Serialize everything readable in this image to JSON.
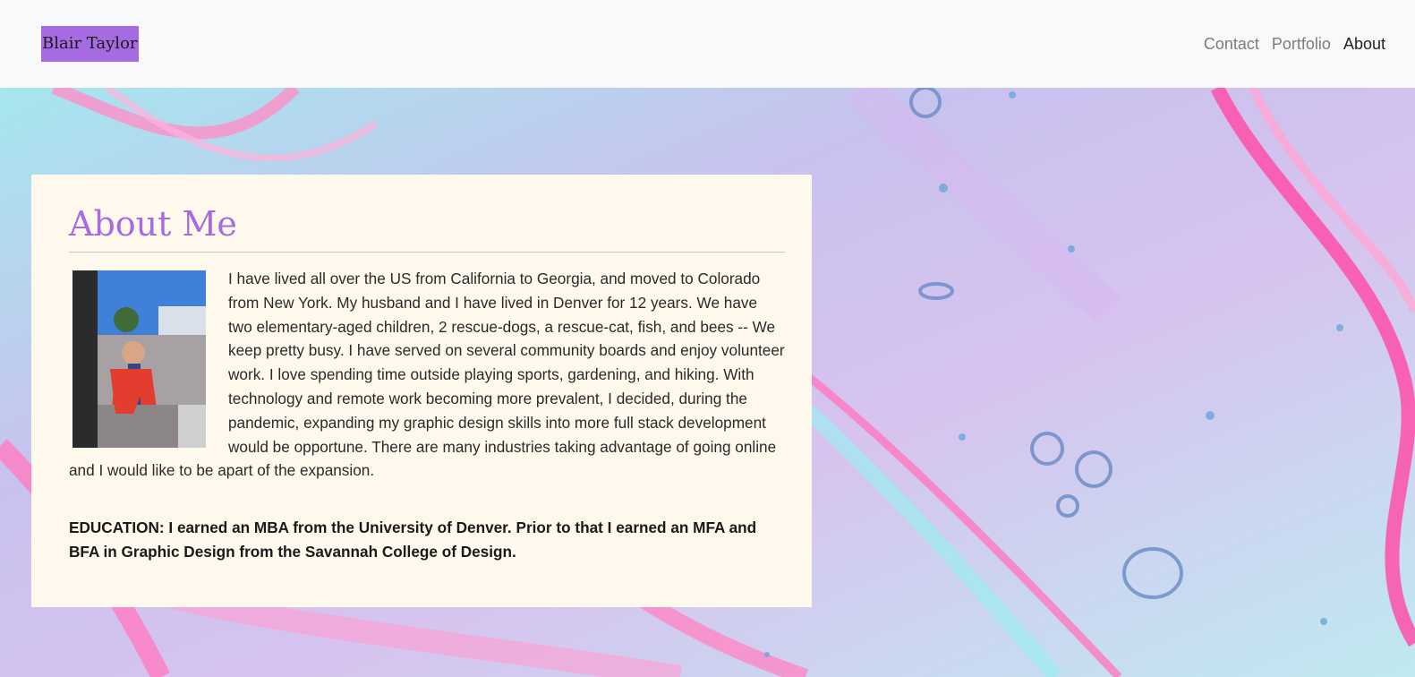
{
  "nav": {
    "brand": "Blair Taylor",
    "links": [
      "Contact",
      "Portfolio",
      "About"
    ],
    "active": "About"
  },
  "about": {
    "heading": "About Me",
    "bio": "I have lived all over the US from California to Georgia, and moved to Colorado from New York. My husband and I have lived in Denver for 12 years. We have two elementary-aged children, 2 rescue-dogs, a rescue-cat, fish, and bees -- We keep pretty busy. I have served on several community boards and enjoy volunteer work. I love spending time outside playing sports, gardening, and hiking. With technology and remote work becoming more prevalent, I decided, during the pandemic, expanding my graphic design skills into more full stack development would be opportune. There are many industries taking advantage of going online and I would like to be apart of the expansion.",
    "education": "EDUCATION: I earned an MBA from the University of Denver. Prior to that I earned an MFA and BFA in Graphic Design from the Savannah College of Design."
  },
  "colors": {
    "brand_bg": "#a66be0",
    "heading": "#a66be0",
    "navbar_bg": "#f8f9fa",
    "card_bg": "#fff9ed"
  },
  "icons": {
    "photo": "profile-photo",
    "background": "fluid-art-background"
  }
}
